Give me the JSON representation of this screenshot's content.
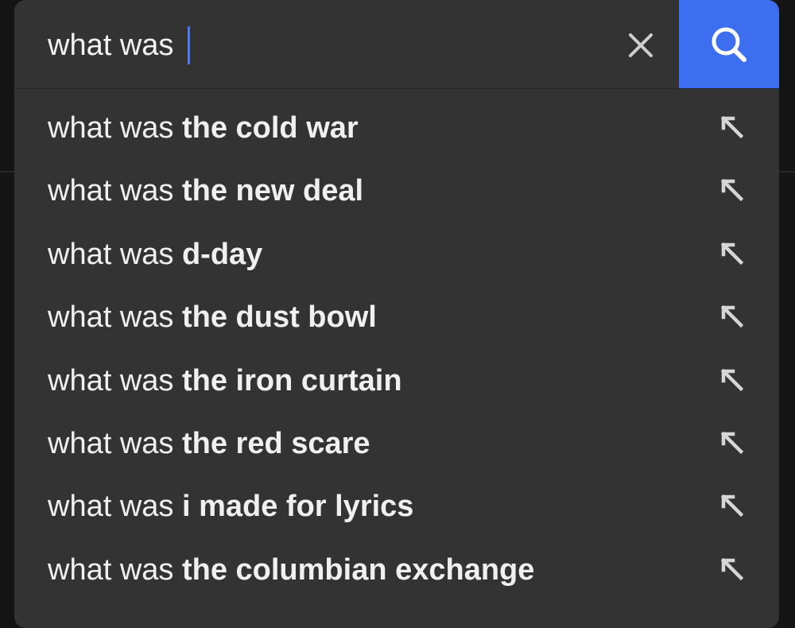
{
  "search": {
    "query": "what was ",
    "clear_icon": "close-icon",
    "search_icon": "search-icon"
  },
  "colors": {
    "panel": "#333333",
    "accent": "#3d6ef0",
    "caret": "#4a7cf0",
    "text": "#f0f0f0"
  },
  "suggestions": [
    {
      "prefix": "what was ",
      "completion": "the cold war",
      "icon": "arrow-up-left-icon"
    },
    {
      "prefix": "what was ",
      "completion": "the new deal",
      "icon": "arrow-up-left-icon"
    },
    {
      "prefix": "what was ",
      "completion": "d-day",
      "icon": "arrow-up-left-icon"
    },
    {
      "prefix": "what was ",
      "completion": "the dust bowl",
      "icon": "arrow-up-left-icon"
    },
    {
      "prefix": "what was ",
      "completion": "the iron curtain",
      "icon": "arrow-up-left-icon"
    },
    {
      "prefix": "what was ",
      "completion": "the red scare",
      "icon": "arrow-up-left-icon"
    },
    {
      "prefix": "what was ",
      "completion": "i made for lyrics",
      "icon": "arrow-up-left-icon"
    },
    {
      "prefix": "what was ",
      "completion": "the columbian exchange",
      "icon": "arrow-up-left-icon"
    }
  ]
}
